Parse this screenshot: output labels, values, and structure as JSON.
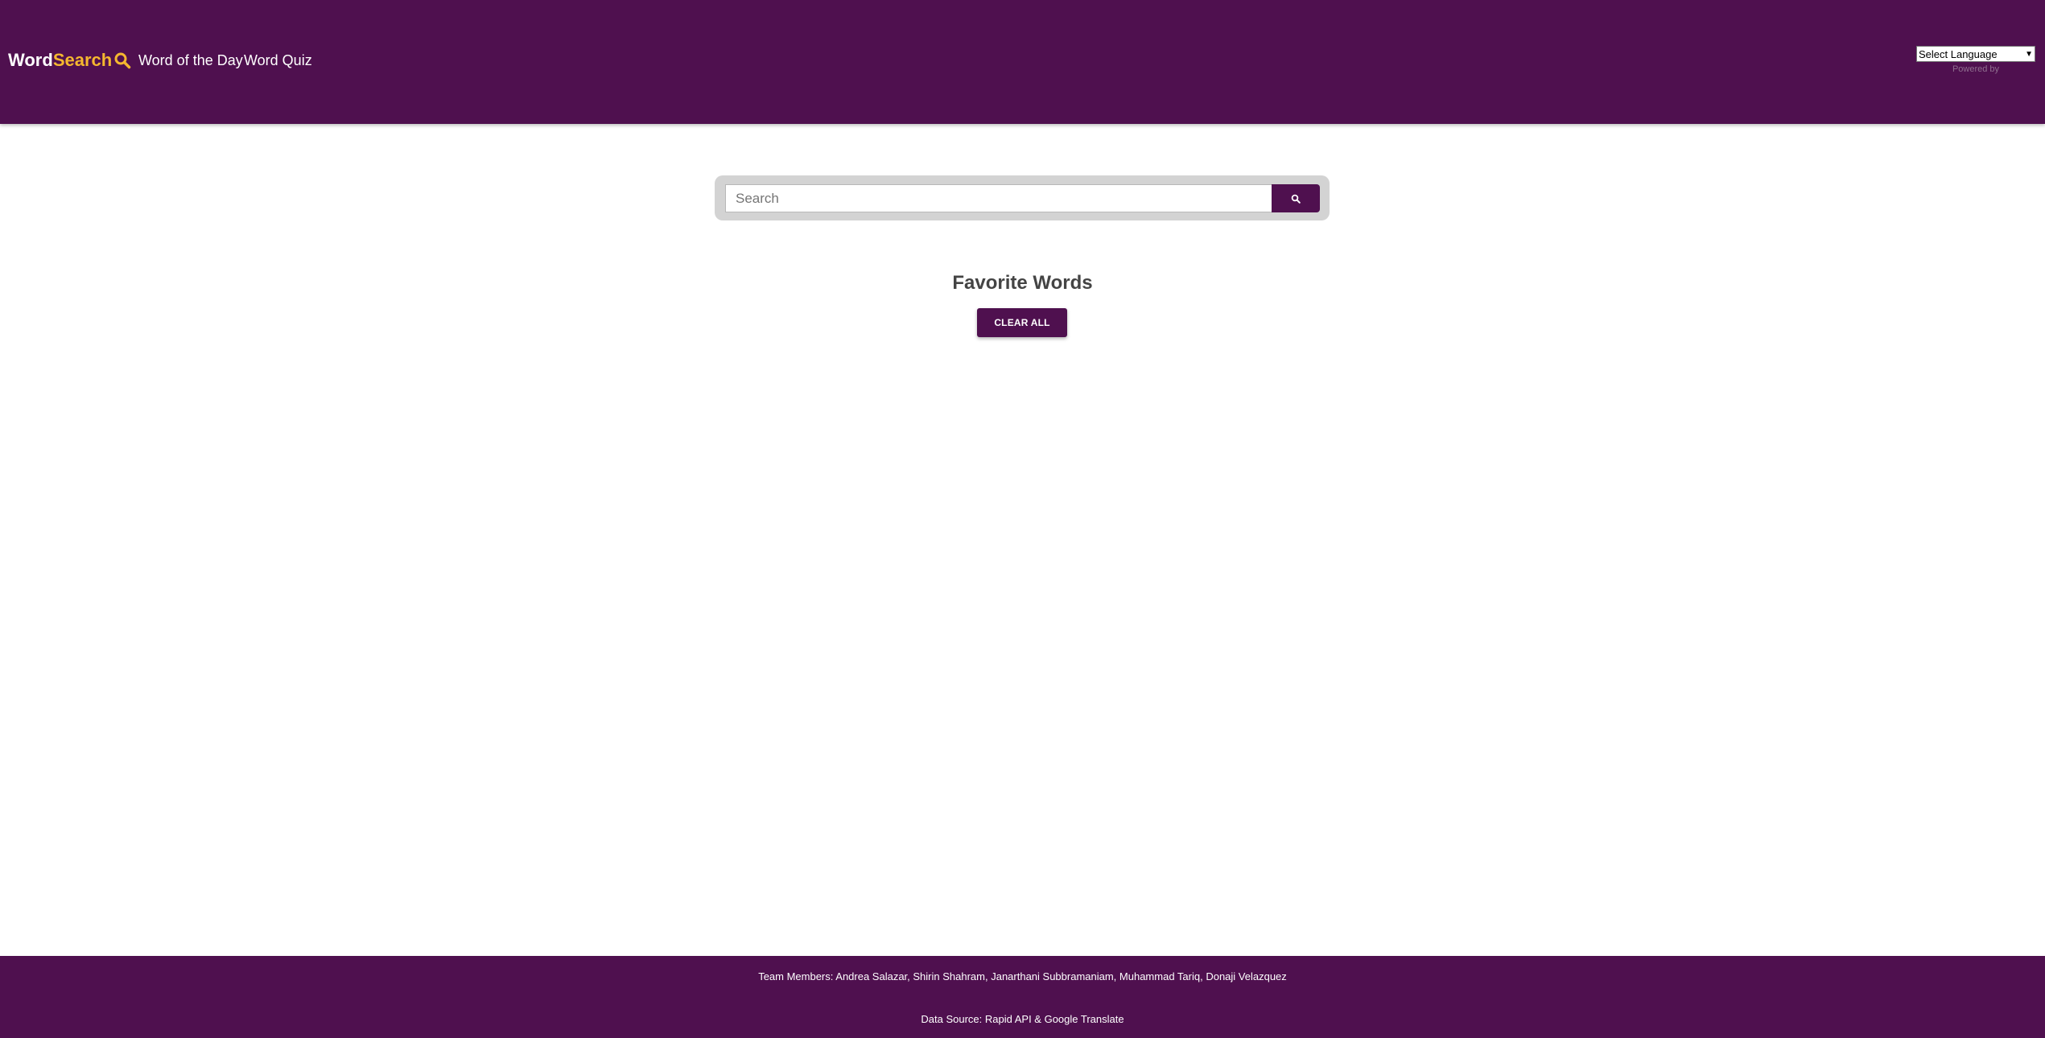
{
  "brand": {
    "word": "Word",
    "search": "Search",
    "icon": "magnifier-icon"
  },
  "nav": {
    "word_of_the_day": "Word of the Day",
    "word_quiz": "Word Quiz"
  },
  "language": {
    "selected": "Select Language",
    "powered_by": "Powered by"
  },
  "search": {
    "placeholder": "Search",
    "button_icon": "search-icon"
  },
  "favorites": {
    "title": "Favorite Words",
    "clear_label": "CLEAR ALL"
  },
  "footer": {
    "team": "Team Members: Andrea Salazar, Shirin Shahram, Janarthani Subbramaniam, Muhammad Tariq, Donaji Velazquez",
    "source": "Data Source: Rapid API & Google Translate"
  },
  "colors": {
    "primary": "#4f104f",
    "accent": "#f5b72f",
    "search_box_bg": "#d3d3d3",
    "heading": "#444444"
  }
}
